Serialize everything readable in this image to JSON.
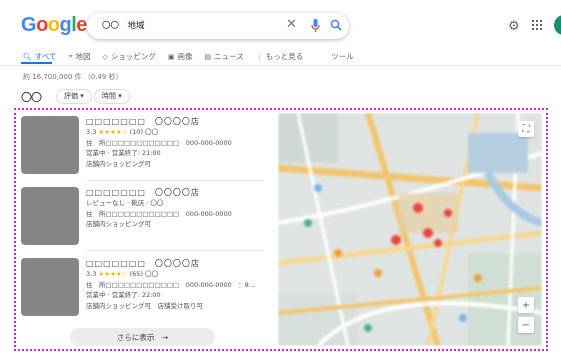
{
  "header": {
    "logo_text": "Google",
    "search_query": "〇〇　地域",
    "logo_colors": [
      "#4285f4",
      "#ea4335",
      "#fbbc05",
      "#4285f4",
      "#34a853",
      "#ea4335"
    ]
  },
  "tabs": [
    {
      "label": "すべて",
      "icon": "search-icon",
      "active": true
    },
    {
      "label": "地図",
      "icon": "map-pin-icon",
      "active": false
    },
    {
      "label": "ショッピング",
      "icon": "tag-icon",
      "active": false
    },
    {
      "label": "画像",
      "icon": "image-icon",
      "active": false
    },
    {
      "label": "ニュース",
      "icon": "news-icon",
      "active": false
    },
    {
      "label": "もっと見る",
      "icon": "more-icon",
      "active": false
    }
  ],
  "tools_label": "ツール",
  "result_count": "約 16,700,000 件 （0.49 秒）",
  "filters": {
    "circles": "〇〇",
    "chips": [
      "評価",
      "時間"
    ]
  },
  "listings": [
    {
      "title": "□□□□□□□　〇〇〇〇店",
      "rating": "3.3",
      "stars": "★★★★☆",
      "reviews": "(10)",
      "category": "〇〇",
      "address": "住　所□□□□□□□□□□□□　000-000-0000",
      "hours": "営業中 · 営業終了: 21:00",
      "service": "店舗内ショッピング可"
    },
    {
      "title": "□□□□□□□　〇〇〇〇店",
      "rating_text": "レビューなし · 靴店 · 〇〇",
      "address": "住　所□□□□□□□□□□□□　000-000-0000",
      "service": "店舗内ショッピング可"
    },
    {
      "title": "□□□□□□□　〇〇〇〇店",
      "rating": "3.3",
      "stars": "★★★★☆",
      "reviews": "(65)",
      "category": "〇〇",
      "address": "住　所□□□□□□□□□□□□　000-000-0000　：8…",
      "hours": "営業中 · 営業終了: 22:00",
      "service": "店舗内ショッピング可　店舗受け取り可"
    }
  ],
  "more_button": "さらに表示　→",
  "colors": {
    "accent": "#1a73e8",
    "highlight": "#e41ad7",
    "star": "#f4b400"
  }
}
